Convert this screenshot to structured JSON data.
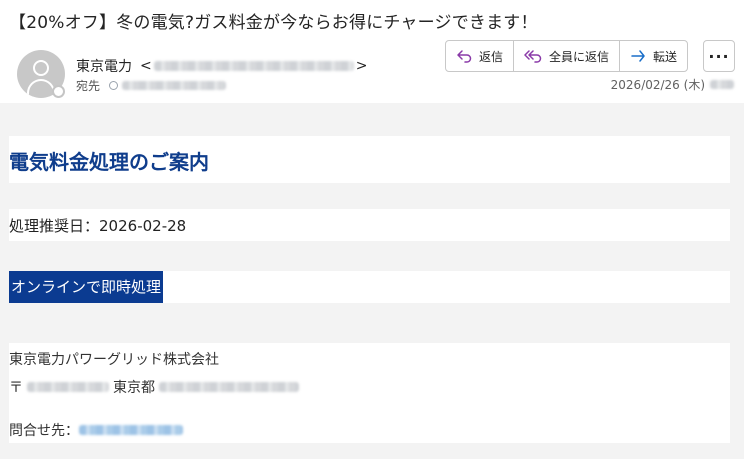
{
  "email": {
    "subject": "【20%オフ】冬の電気?ガス料金が今ならお得にチャージできます！",
    "sender": {
      "name": "東京電力",
      "open_bracket": "<",
      "close_bracket": ">"
    },
    "to_label": "宛先",
    "date": "2026/02/26 (木)",
    "actions": {
      "reply": "返信",
      "reply_all": "全員に返信",
      "forward": "転送",
      "more": "···"
    }
  },
  "message": {
    "heading": "電気料金処理のご案内",
    "due_date_label": "処理推奨日：",
    "due_date_value": "2026-02-28",
    "link_text": "オンラインで即時処理",
    "company": "東京電力パワーグリッド株式会社",
    "postal_mark": "〒",
    "prefecture": "東京都",
    "contact_label": "問合せ先："
  },
  "colors": {
    "heading": "#0f3d8c",
    "link_bg": "#0b3b91",
    "body_bg": "#f3f3f3",
    "reply_icon": "#8a3aa8",
    "forward_icon": "#1a6fc9"
  },
  "icons": {
    "avatar": "person-icon",
    "reply": "reply-arrow-icon",
    "reply_all": "reply-all-arrow-icon",
    "forward": "forward-arrow-icon",
    "more": "more-horizontal-icon",
    "presence": "presence-ring-icon"
  }
}
